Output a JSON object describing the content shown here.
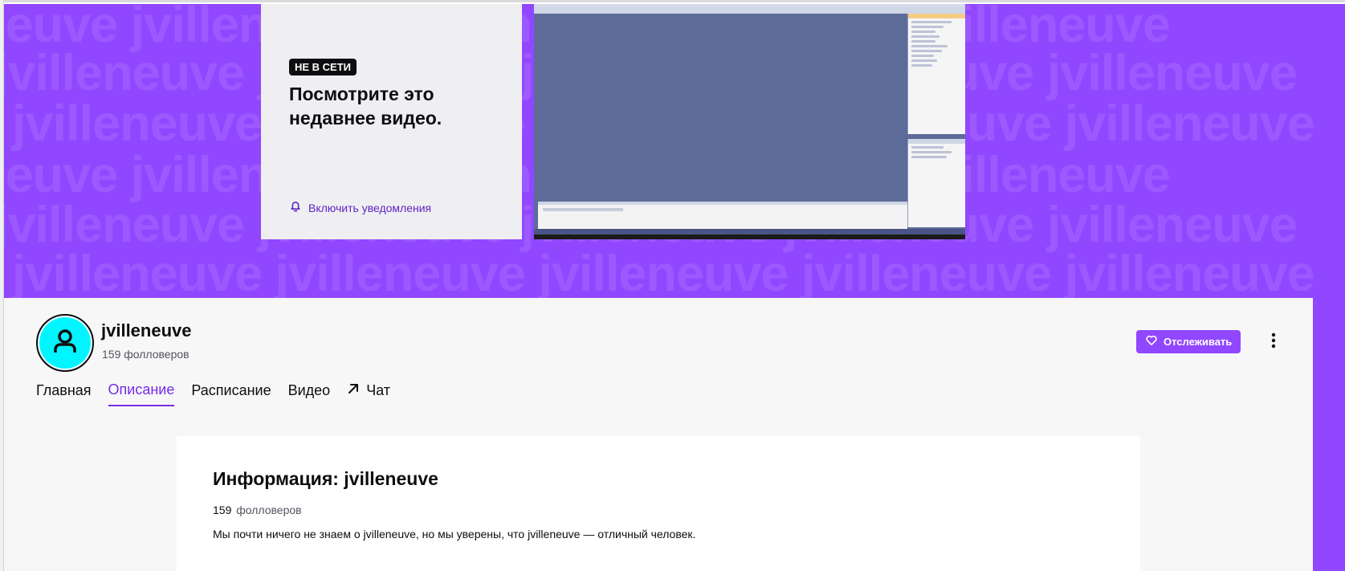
{
  "banner": {
    "watermark": "jvilleneuve",
    "colors": {
      "background": "#9147ff"
    }
  },
  "offline_card": {
    "badge": "НЕ В СЕТИ",
    "title": "Посмотрите это недавнее видео.",
    "notify_label": "Включить уведомления",
    "notify_icon": "bell-icon"
  },
  "channel": {
    "name": "jvilleneuve",
    "followers": "159 фолловеров",
    "follow_label": "Отслеживать",
    "follow_icon": "heart-icon",
    "more_icon": "kebab-menu-icon",
    "avatar_icon": "user-icon",
    "avatar_color": "#00f5ff"
  },
  "tabs": [
    {
      "label": "Главная"
    },
    {
      "label": "Описание",
      "active": true
    },
    {
      "label": "Расписание"
    },
    {
      "label": "Видео"
    },
    {
      "label": "Чат",
      "icon": "external-arrow-icon"
    }
  ],
  "about": {
    "title": "Информация: jvilleneuve",
    "followers_count": "159",
    "followers_label": "фолловеров",
    "description": "Мы почти ничего не знаем о jvilleneuve, но мы уверены, что jvilleneuve — отличный человек."
  },
  "colors": {
    "accent": "#9147ff",
    "accent_text": "#772ce8"
  }
}
